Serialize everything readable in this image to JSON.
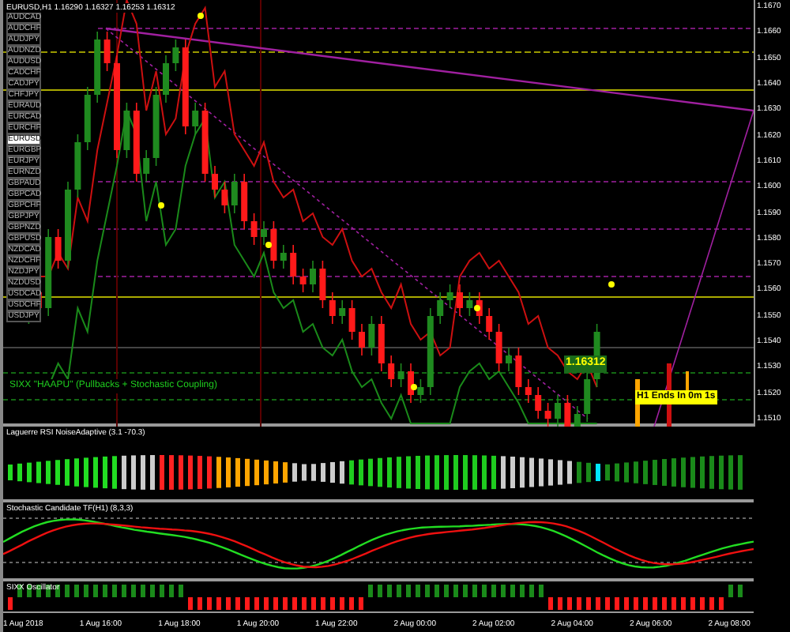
{
  "window": {
    "title": "EURUSD,H1 1.16290 1.16327 1.16253 1.16312"
  },
  "symbols": [
    {
      "label": "AUDCAD",
      "selected": false
    },
    {
      "label": "AUDCHF",
      "selected": false
    },
    {
      "label": "AUDJPY",
      "selected": false
    },
    {
      "label": "AUDNZD",
      "selected": false
    },
    {
      "label": "AUDUSD",
      "selected": false
    },
    {
      "label": "CADCHF",
      "selected": false
    },
    {
      "label": "CADJPY",
      "selected": false
    },
    {
      "label": "CHFJPY",
      "selected": false
    },
    {
      "label": "EURAUD",
      "selected": false
    },
    {
      "label": "EURCAD",
      "selected": false
    },
    {
      "label": "EURCHF",
      "selected": false
    },
    {
      "label": "EURUSD",
      "selected": true
    },
    {
      "label": "EURGBP",
      "selected": false
    },
    {
      "label": "EURJPY",
      "selected": false
    },
    {
      "label": "EURNZD",
      "selected": false
    },
    {
      "label": "GBPAUD",
      "selected": false
    },
    {
      "label": "GBPCAD",
      "selected": false
    },
    {
      "label": "GBPCHF",
      "selected": false
    },
    {
      "label": "GBPJPY",
      "selected": false
    },
    {
      "label": "GBPNZD",
      "selected": false
    },
    {
      "label": "GBPUSD",
      "selected": false
    },
    {
      "label": "NZDCAD",
      "selected": false
    },
    {
      "label": "NZDCHF",
      "selected": false
    },
    {
      "label": "NZDJPY",
      "selected": false
    },
    {
      "label": "NZDUSD",
      "selected": false
    },
    {
      "label": "USDCAD",
      "selected": false
    },
    {
      "label": "USDCHF",
      "selected": false
    },
    {
      "label": "USDJPY",
      "selected": false
    }
  ],
  "price_axis": [
    "1.1670",
    "1.1660",
    "1.1650",
    "1.1640",
    "1.1630",
    "1.1620",
    "1.1610",
    "1.1600",
    "1.1590",
    "1.1580",
    "1.1570",
    "1.1560",
    "1.1550",
    "1.1540",
    "1.1530",
    "1.1520",
    "1.1510"
  ],
  "current_price": "1.16312",
  "timer": "H1 Ends In 0m 1s",
  "main_note": "SIXX \"HAAPU\" (Pullbacks + Stochastic Coupling)",
  "indicators": [
    {
      "title": "Laguerre RSI NoiseAdaptive (3.1 -70.3)"
    },
    {
      "title": "Stochastic Candidate TF(H1) (8,3,3)"
    },
    {
      "title": "SIXX Oscillator"
    }
  ],
  "time_axis": [
    "1 Aug 2018",
    "1 Aug 16:00",
    "1 Aug 18:00",
    "1 Aug 20:00",
    "1 Aug 22:00",
    "2 Aug 00:00",
    "2 Aug 02:00",
    "2 Aug 04:00",
    "2 Aug 06:00",
    "2 Aug 08:00"
  ]
}
